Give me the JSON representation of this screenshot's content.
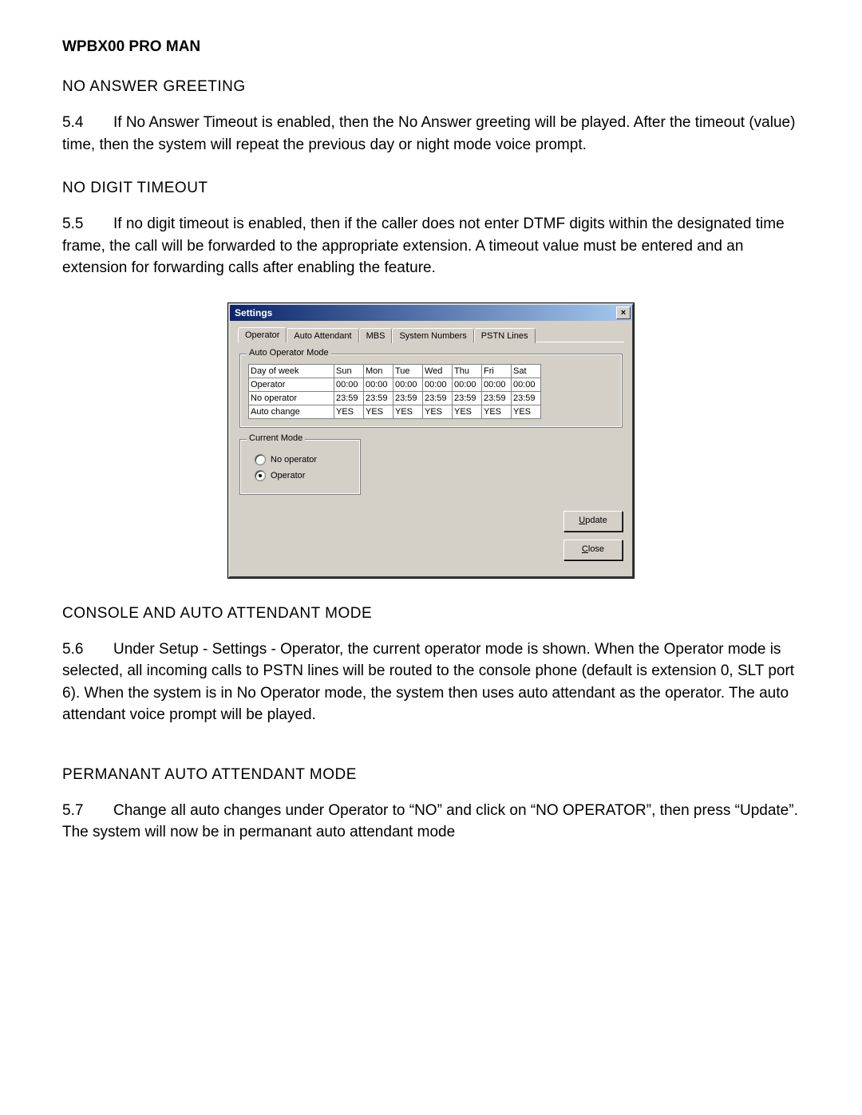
{
  "doc": {
    "title": "WPBX00 PRO MAN",
    "sections": [
      {
        "heading": "NO ANSWER GREETING",
        "num": "5.4",
        "text": "If No Answer Timeout is enabled, then the No Answer greeting will be played.  After the timeout (value) time, then the system will repeat the previous day or night mode voice prompt."
      },
      {
        "heading": "NO DIGIT TIMEOUT",
        "num": "5.5",
        "text": "If no digit timeout is enabled, then if the caller does not enter DTMF digits  within the designated time frame, the call will be forwarded to the appropriate extension.  A timeout value must be entered and an extension for forwarding calls after enabling the feature."
      },
      {
        "heading": "CONSOLE AND AUTO ATTENDANT MODE",
        "num": "5.6",
        "text": "Under Setup - Settings - Operator, the current operator mode is shown.  When the Operator mode is selected, all incoming calls to PSTN lines will be routed to  the console phone (default is extension 0, SLT  port 6).  When the system is in No Operator mode, the system then uses auto attendant as the operator.  The auto attendant voice prompt will be played."
      },
      {
        "heading": "PERMANANT AUTO ATTENDANT MODE",
        "num": "5.7",
        "text": "Change all auto changes under Operator to “NO” and click on “NO OPERATOR”, then press “Update”.  The system will now be in permanant auto attendant mode"
      }
    ]
  },
  "dialog": {
    "title": "Settings",
    "close_glyph": "×",
    "tabs": [
      "Operator",
      "Auto Attendant",
      "MBS",
      "System Numbers",
      "PSTN Lines"
    ],
    "active_tab_index": 0,
    "group1": {
      "label": "Auto Operator Mode",
      "header_row": [
        "Day of week",
        "Sun",
        "Mon",
        "Tue",
        "Wed",
        "Thu",
        "Fri",
        "Sat"
      ],
      "rows": [
        {
          "label": "Operator",
          "cells": [
            "00:00",
            "00:00",
            "00:00",
            "00:00",
            "00:00",
            "00:00",
            "00:00"
          ]
        },
        {
          "label": "No operator",
          "cells": [
            "23:59",
            "23:59",
            "23:59",
            "23:59",
            "23:59",
            "23:59",
            "23:59"
          ]
        },
        {
          "label": "Auto change",
          "cells": [
            "YES",
            "YES",
            "YES",
            "YES",
            "YES",
            "YES",
            "YES"
          ]
        }
      ]
    },
    "group2": {
      "label": "Current Mode",
      "options": [
        {
          "label": "No operator",
          "selected": false
        },
        {
          "label": "Operator",
          "selected": true
        }
      ]
    },
    "buttons": {
      "update_prefix": "U",
      "update_rest": "pdate",
      "close_prefix": "C",
      "close_rest": "lose"
    }
  }
}
